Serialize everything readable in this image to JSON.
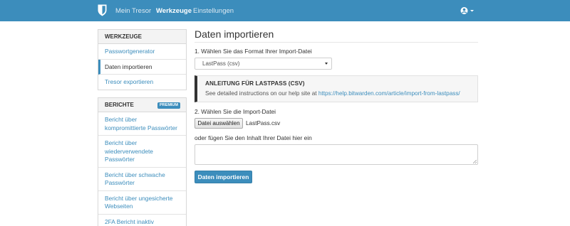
{
  "navbar": {
    "logo_icon": "shield-icon",
    "links": [
      "Mein Tresor",
      "Werkzeuge",
      "Einstellungen"
    ],
    "active_link": "Werkzeuge",
    "account_icon": "user-circle-icon",
    "background": "#3c8dbc"
  },
  "sidebar": {
    "tools": {
      "heading": "WERKZEUGE",
      "items": [
        "Passwortgenerator",
        "Daten importieren",
        "Tresor exportieren"
      ],
      "active": "Daten importieren"
    },
    "reports": {
      "heading": "BERICHTE",
      "badge": "PREMIUM",
      "items": [
        "Bericht über kompromittierte Passwörter",
        "Bericht über wiederverwendete Passwörter",
        "Bericht über schwache Passwörter",
        "Bericht über ungesicherte Webseiten",
        "2FA Bericht inaktiv"
      ]
    }
  },
  "main": {
    "title": "Daten importieren",
    "step1_label": "1. Wählen Sie das Format Ihrer Import-Datei",
    "format_select_value": "LastPass (csv)",
    "callout": {
      "title": "ANLEITUNG FÜR LASTPASS (CSV)",
      "text": "See detailed instructions on our help site at",
      "link": "https://help.bitwarden.com/article/import-from-lastpass/"
    },
    "step2_label": "2. Wählen Sie die Import-Datei",
    "file_button": "Datei auswählen",
    "file_name": "LastPass.csv",
    "paste_label": "oder fügen Sie den Inhalt Ihrer Datei hier ein",
    "submit_button": "Daten importieren"
  },
  "colors": {
    "accent": "#3c8dbc",
    "page_background": "#eeeeee"
  }
}
